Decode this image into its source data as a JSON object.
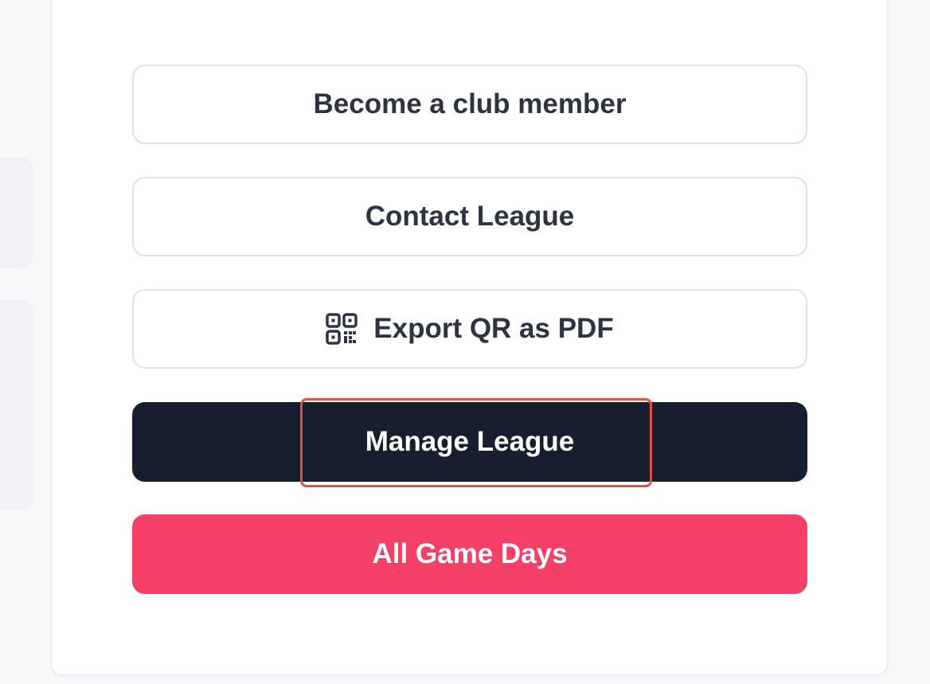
{
  "actions": {
    "become_member_label": "Become a club member",
    "contact_league_label": "Contact League",
    "export_qr_label": "Export QR as PDF",
    "export_qr_icon": "qr-code-icon",
    "manage_league_label": "Manage League",
    "all_game_days_label": "All Game Days"
  },
  "colors": {
    "primary_dark": "#171e2e",
    "accent_pink": "#f43f67",
    "highlight_outline": "#d9534a",
    "outline_border": "#dde1e7",
    "text_dark": "#2d3441"
  }
}
